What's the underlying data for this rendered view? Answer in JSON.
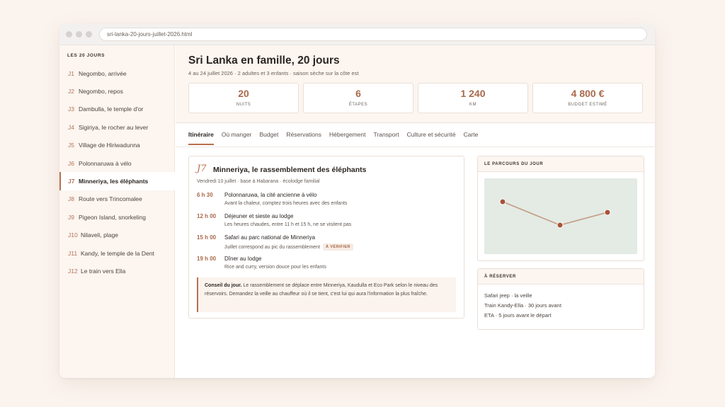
{
  "browser": {
    "url": "sri-lanka-20-jours-juillet-2026.html"
  },
  "sidebar": {
    "title": "LES 20 JOURS",
    "items": [
      {
        "num": "J1",
        "label": "Negombo, arrivée"
      },
      {
        "num": "J2",
        "label": "Negombo, repos"
      },
      {
        "num": "J3",
        "label": "Dambulla, le temple d'or"
      },
      {
        "num": "J4",
        "label": "Sigiriya, le rocher au lever"
      },
      {
        "num": "J5",
        "label": "Village de Hiriwadunna"
      },
      {
        "num": "J6",
        "label": "Polonnaruwa à vélo"
      },
      {
        "num": "J7",
        "label": "Minneriya, les éléphants",
        "active": true
      },
      {
        "num": "J8",
        "label": "Route vers Trincomalee"
      },
      {
        "num": "J9",
        "label": "Pigeon Island, snorkeling"
      },
      {
        "num": "J10",
        "label": "Nilaveli, plage"
      },
      {
        "num": "J11",
        "label": "Kandy, le temple de la Dent"
      },
      {
        "num": "J12",
        "label": "Le train vers Ella"
      }
    ]
  },
  "header": {
    "title": "Sri Lanka en famille, 20 jours",
    "subtitle": "4 au 24 juillet 2026 · 2 adultes et 3 enfants · saison sèche sur la côte est",
    "stats": [
      {
        "value": "20",
        "label": "NUITS"
      },
      {
        "value": "6",
        "label": "ÉTAPES"
      },
      {
        "value": "1 240",
        "label": "KM"
      },
      {
        "value": "4 800 €",
        "label": "BUDGET ESTIMÉ"
      }
    ]
  },
  "tabs": [
    {
      "label": "Itinéraire",
      "active": true
    },
    {
      "label": "Où manger"
    },
    {
      "label": "Budget"
    },
    {
      "label": "Réservations"
    },
    {
      "label": "Hébergement"
    },
    {
      "label": "Transport"
    },
    {
      "label": "Culture et sécurité"
    },
    {
      "label": "Carte"
    }
  ],
  "day": {
    "tag": "J7",
    "title": "Minneriya, le rassemblement des éléphants",
    "subtitle": "Vendredi 10 juillet · base à Habarana · écolodge familial",
    "schedule": [
      {
        "time": "6 h 30",
        "title": "Polonnaruwa, la cité ancienne à vélo",
        "desc": "Avant la chaleur, comptez trois heures avec des enfants"
      },
      {
        "time": "12 h 00",
        "title": "Déjeuner et sieste au lodge",
        "desc": "Les heures chaudes, entre 11 h et 15 h, ne se visitent pas"
      },
      {
        "time": "15 h 00",
        "title": "Safari au parc national de Minneriya",
        "desc": "Juillet correspond au pic du rassemblement",
        "badge": "À VÉRIFIER"
      },
      {
        "time": "19 h 00",
        "title": "Dîner au lodge",
        "desc": "Rice and curry, version douce pour les enfants"
      }
    ],
    "tip": {
      "label": "Conseil du jour.",
      "text": "Le rassemblement se déplace entre Minneriya, Kaudulla et Eco Park selon le niveau des réservoirs. Demandez la veille au chauffeur où il se tient, c'est lui qui aura l'information la plus fraîche."
    }
  },
  "route_panel": {
    "title": "LE PARCOURS DU JOUR"
  },
  "reserve_panel": {
    "title": "À RÉSERVER",
    "items": [
      "Safari jeep · la veille",
      "Train Kandy-Ella · 30 jours avant",
      "ETA · 5 jours avant le départ"
    ]
  },
  "colors": {
    "accent": "#b8704f",
    "stat_value": "#a86a4c",
    "map_bg": "#e3ebe4",
    "route_line": "#c49a83",
    "route_point": "#a9523a"
  }
}
